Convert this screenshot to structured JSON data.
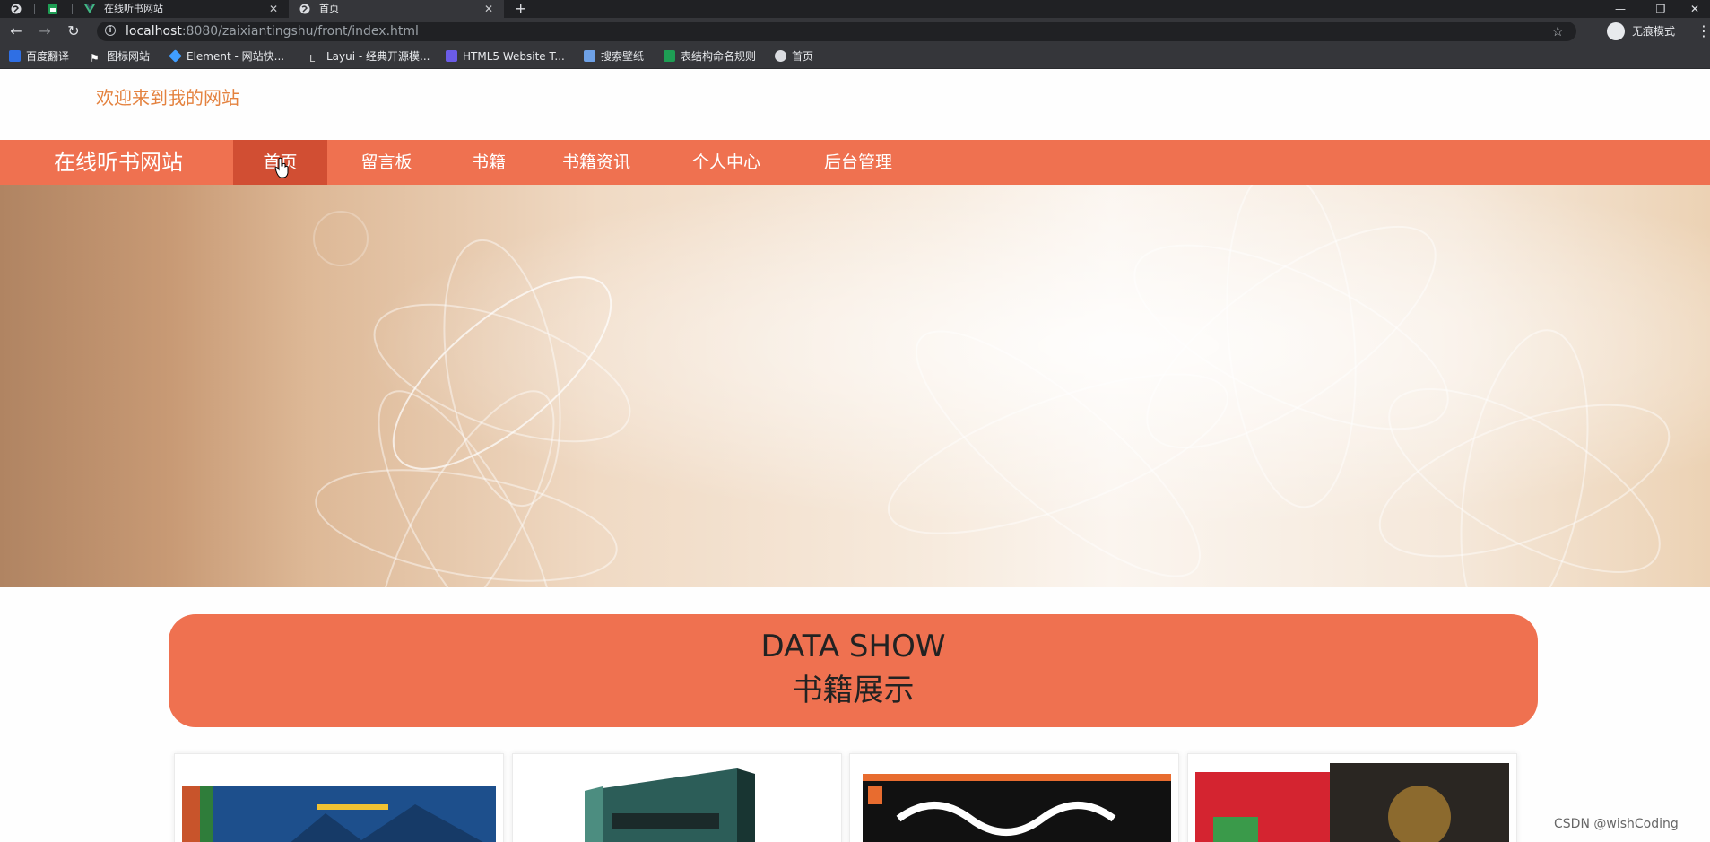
{
  "browser": {
    "tabs": [
      {
        "title": "",
        "icon": "globe-icon"
      },
      {
        "title": "",
        "icon": "sheet-icon"
      },
      {
        "title": "在线听书网站",
        "icon": "vue-icon"
      },
      {
        "title": "首页",
        "icon": "globe-icon",
        "active": true
      }
    ],
    "new_tab": "+",
    "url_host": "localhost",
    "url_rest": ":8080/zaixiantingshu/front/index.html",
    "incognito_label": "无痕模式",
    "bookmarks": [
      {
        "label": "百度翻译",
        "icon": "baidu-translate-icon",
        "color": "#2f6fe4"
      },
      {
        "label": "图标网站",
        "icon": "flag-icon",
        "color": "#ffffff"
      },
      {
        "label": "Element - 网站快...",
        "icon": "element-icon",
        "color": "#409eff"
      },
      {
        "label": "Layui - 经典开源模...",
        "icon": "layui-icon",
        "color": "#cfcfcf"
      },
      {
        "label": "HTML5 Website T...",
        "icon": "html5-icon",
        "color": "#6b5ce7"
      },
      {
        "label": "搜索壁纸",
        "icon": "wallpaper-icon",
        "color": "#6ea1e6"
      },
      {
        "label": "表结构命名规则",
        "icon": "sheet-icon",
        "color": "#1e9e54"
      },
      {
        "label": "首页",
        "icon": "globe-icon",
        "color": "#dadce0"
      }
    ]
  },
  "site": {
    "welcome": "欢迎来到我的网站",
    "brand": "在线听书网站",
    "nav": [
      "首页",
      "留言板",
      "书籍",
      "书籍资讯",
      "个人中心",
      "后台管理"
    ],
    "active_nav": "首页",
    "carousel": {
      "slides": 3,
      "active": 1
    },
    "section_title_en": "DATA SHOW",
    "section_title_zh": "书籍展示",
    "watermark": "CSDN @wishCoding",
    "colors": {
      "primary": "#ef7150",
      "active_nav": "#d14e33",
      "welcome": "#e4823f"
    }
  }
}
